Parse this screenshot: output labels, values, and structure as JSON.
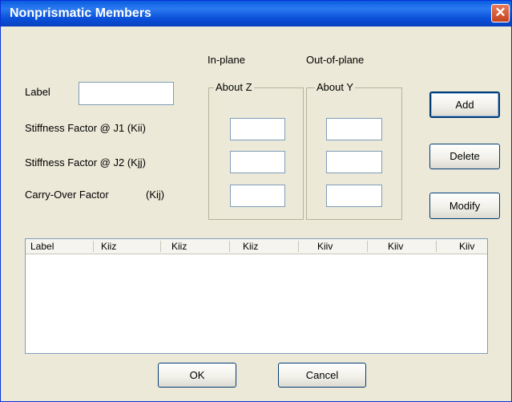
{
  "window": {
    "title": "Nonprismatic Members",
    "close_glyph": "✕"
  },
  "form": {
    "label_text": "Label",
    "label_value": "",
    "stiffness_j1": "Stiffness Factor @ J1 (Kii)",
    "stiffness_j2": "Stiffness Factor @ J2 (Kjj)",
    "carry_over": "Carry-Over Factor",
    "carry_over_symbol": "(Kij)"
  },
  "headers": {
    "in_plane": "In-plane",
    "out_of_plane": "Out-of-plane"
  },
  "groups": {
    "about_z": "About Z",
    "about_y": "About Y"
  },
  "fields": {
    "z_kii": "",
    "z_kjj": "",
    "z_kij": "",
    "y_kii": "",
    "y_kjj": "",
    "y_kij": ""
  },
  "buttons": {
    "add": "Add",
    "delete": "Delete",
    "modify": "Modify",
    "ok": "OK",
    "cancel": "Cancel"
  },
  "table": {
    "columns": [
      "Label",
      "Kiiz",
      "Kiiz",
      "Kiiz",
      "Kiiv",
      "Kiiv",
      "Kiiv"
    ],
    "rows": []
  }
}
